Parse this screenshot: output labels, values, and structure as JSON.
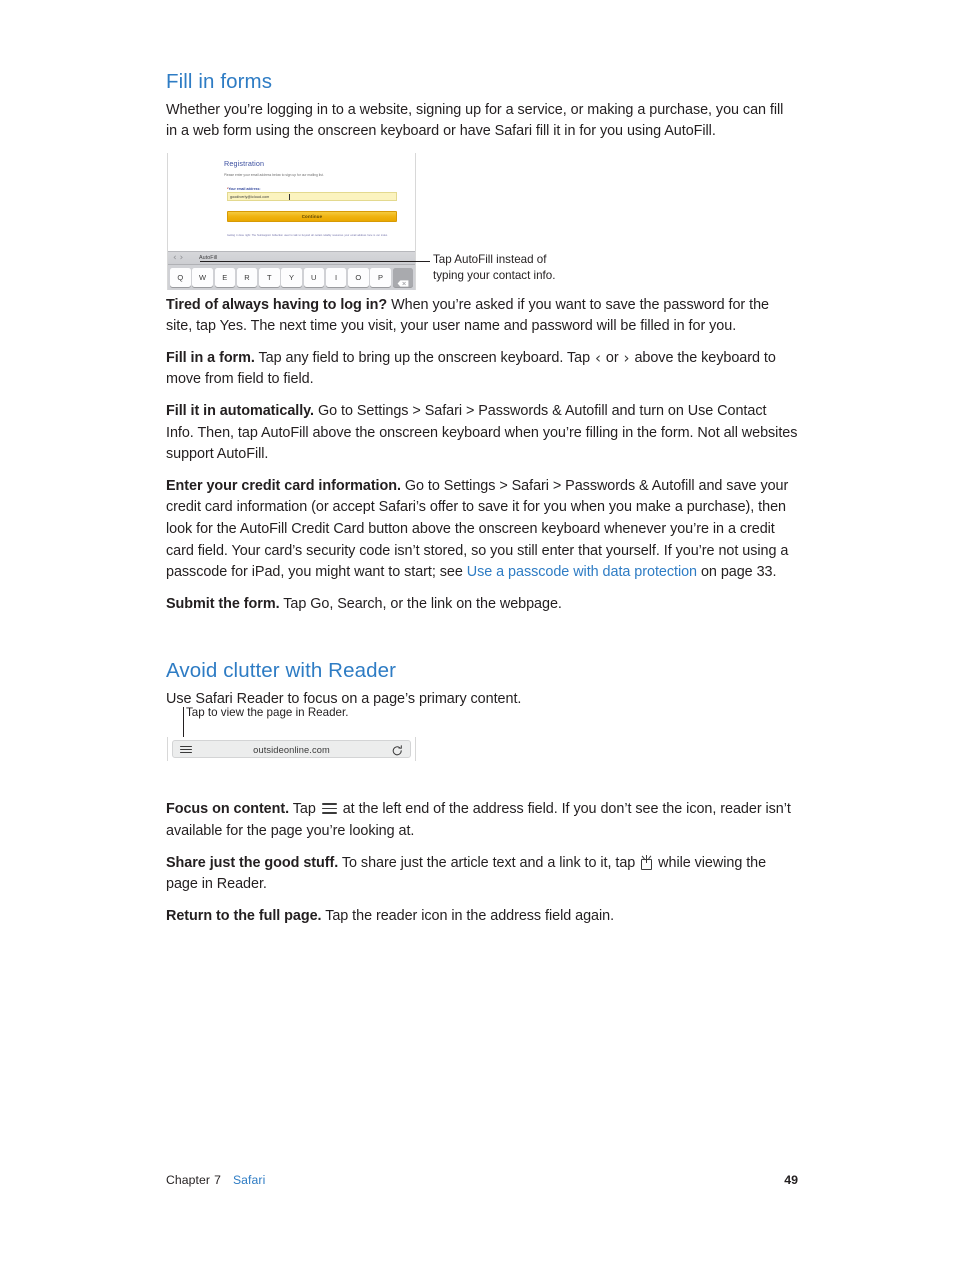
{
  "sections": [
    {
      "id": "fill-in-forms",
      "title": "Fill in forms",
      "intro": "Whether you’re logging in to a website, signing up for a service, or making a purchase, you can fill in a web form using the onscreen keyboard or have Safari fill it in for you using AutoFill."
    },
    {
      "id": "avoid-clutter",
      "title": "Avoid clutter with Reader",
      "intro": "Use Safari Reader to focus on a page’s primary content."
    }
  ],
  "figure_form": {
    "registration_title": "Registration",
    "registration_subtitle": "Please enter your email address below to sign up for our mailing list.",
    "field_label_required_mark": "*",
    "field_label": "Your email address:",
    "field_value": "goodiverly@icloud.com",
    "submit_button": "Continue",
    "fine_print": "Getting it done right: The Nutrisupport Collection used to talk to beyond all certain reliably resources your email address here is our index.",
    "accessory_prev": "‹",
    "accessory_next": "›",
    "accessory_autofill": "AutoFill",
    "keyboard_keys": [
      "Q",
      "W",
      "E",
      "R",
      "T",
      "Y",
      "U",
      "I",
      "O",
      "P"
    ],
    "caption_line1": "Tap AutoFill instead of",
    "caption_line2": "typing your contact info."
  },
  "figure_reader": {
    "caption": "Tap to view the page in Reader.",
    "url": "outsideonline.com",
    "reader_icon_name": "reader-icon",
    "refresh_icon_name": "refresh-icon"
  },
  "paragraphs": {
    "tired": {
      "lead": "Tired of always having to log in?",
      "rest": " When you’re asked if you want to save the password for the site, tap Yes. The next time you visit, your user name and password will be filled in for you."
    },
    "fill_form": {
      "lead": "Fill in a form.",
      "part1": " Tap any field to bring up the onscreen keyboard. Tap ",
      "chevron_left": "‹",
      "mid": " or ",
      "chevron_right": "›",
      "part2": " above the keyboard to move from field to field."
    },
    "automatic": {
      "lead": "Fill it in automatically.",
      "rest": " Go to Settings > Safari > Passwords & Autofill and turn on Use Contact Info. Then, tap AutoFill above the onscreen keyboard when you’re filling in the form. Not all websites support AutoFill."
    },
    "credit_card": {
      "lead": "Enter your credit card information.",
      "part1": " Go to Settings > Safari > Passwords & Autofill and save your credit card information (or accept Safari’s offer to save it for you when you make a purchase), then look for the AutoFill Credit Card button above the onscreen keyboard whenever you’re in a credit card field. Your card’s security code isn’t stored, so you still enter that yourself. If you’re not using a passcode for iPad, you might want to start; see ",
      "link": "Use a passcode with data protection",
      "part2": " on page 33."
    },
    "submit": {
      "lead": "Submit the form.",
      "rest": " Tap Go, Search, or the link on the webpage."
    },
    "focus": {
      "lead": "Focus on content.",
      "part1": " Tap ",
      "part2": " at the left end of the address field. If you don’t see the icon, reader isn’t available for the page you’re looking at."
    },
    "share": {
      "lead": "Share just the good stuff.",
      "part1": " To share just the article text and a link to it, tap ",
      "part2": " while viewing the page in Reader."
    },
    "return_full": {
      "lead": "Return to the full page.",
      "rest": " Tap the reader icon in the address field again."
    }
  },
  "footer": {
    "chapter_word": "Chapter",
    "chapter_number": "7",
    "chapter_name": "Safari",
    "page_number": "49"
  },
  "colors": {
    "heading_blue": "#2e7cc4",
    "link_blue": "#2e7cc4",
    "body_text": "#231f20",
    "form_button_gold": "#f0b310",
    "form_input_yellow": "#fbf3bf"
  }
}
